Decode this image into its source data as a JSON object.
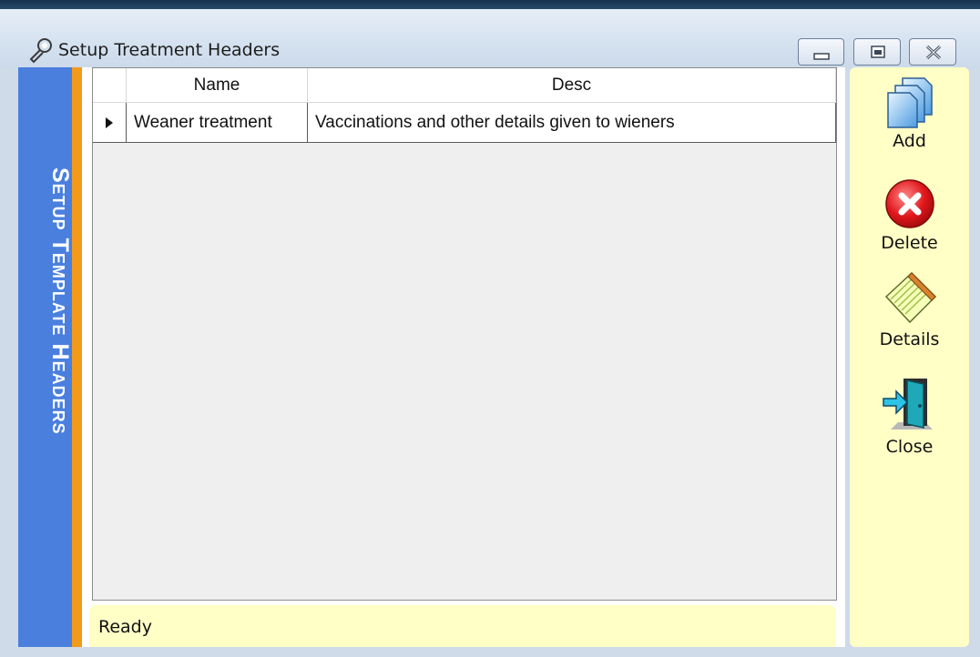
{
  "window": {
    "title": "Setup Treatment Headers",
    "banner": "Setup Template Headers"
  },
  "grid": {
    "columns": [
      "Name",
      "Desc"
    ],
    "rows": [
      {
        "name": "Weaner treatment",
        "desc": "Vaccinations and other details given to wieners",
        "selected": true
      }
    ]
  },
  "toolbar": {
    "add_label": "Add",
    "delete_label": "Delete",
    "details_label": "Details",
    "close_label": "Close"
  },
  "status": {
    "text": "Ready"
  },
  "colors": {
    "banner": "#4a7fde",
    "accent_orange": "#f39a1b",
    "panel_yellow": "#ffffc6"
  },
  "icons": {
    "app": "wrench-icon",
    "add": "add-documents-icon",
    "delete": "delete-x-icon",
    "details": "notepad-icon",
    "close": "exit-door-icon"
  }
}
